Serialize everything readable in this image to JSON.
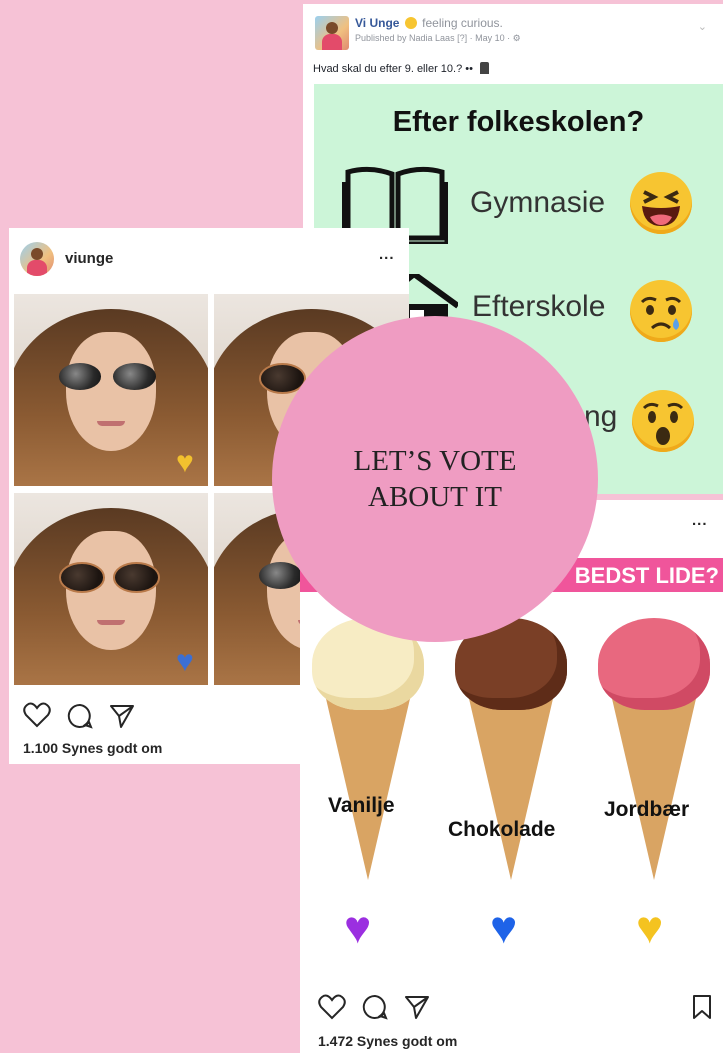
{
  "facebook_post": {
    "page_name": "Vi Unge",
    "feeling": "feeling curious.",
    "meta": "Published by Nadia Laas [?] · May 10 · ",
    "gear_icon": "gear-icon",
    "text": "Hvad skal du efter 9. eller 10.?",
    "graphic": {
      "title": "Efter folkeskolen?",
      "options": [
        {
          "label": "Gymnasie",
          "icon": "book-icon",
          "reaction": "laughing-face"
        },
        {
          "label": "Efterskole",
          "icon": "house-icon",
          "reaction": "crying-face"
        },
        {
          "label": "ng",
          "icon": "",
          "reaction": "surprised-face"
        }
      ]
    }
  },
  "instagram_left": {
    "username": "viunge",
    "more_label": "...",
    "photos": [
      {
        "heart": "yellow-heart",
        "heart_color": "#f2c12e"
      },
      {
        "heart": "",
        "heart_color": ""
      },
      {
        "heart": "blue-heart",
        "heart_color": "#3b6fd4"
      },
      {
        "heart": "",
        "heart_color": ""
      }
    ],
    "likes": "1.100 Synes godt om"
  },
  "instagram_right": {
    "more_label": "...",
    "banner": "BEDST LIDE?",
    "flavors": [
      {
        "name": "Vanilje",
        "scoop_color": "#f7ecc4",
        "heart_color": "#9b2fe0"
      },
      {
        "name": "Chokolade",
        "scoop_color": "#7a3f26",
        "heart_color": "#1e63e8"
      },
      {
        "name": "Jordbær",
        "scoop_color": "#e8687f",
        "heart_color": "#f4c320"
      }
    ],
    "likes": "1.472 Synes godt om"
  },
  "overlay": {
    "text": "LET’S VOTE\nABOUT IT",
    "color": "#ef9cc2"
  },
  "colors": {
    "background": "#f6c2d6",
    "banner": "#f0559b",
    "facebook_link": "#365899"
  }
}
